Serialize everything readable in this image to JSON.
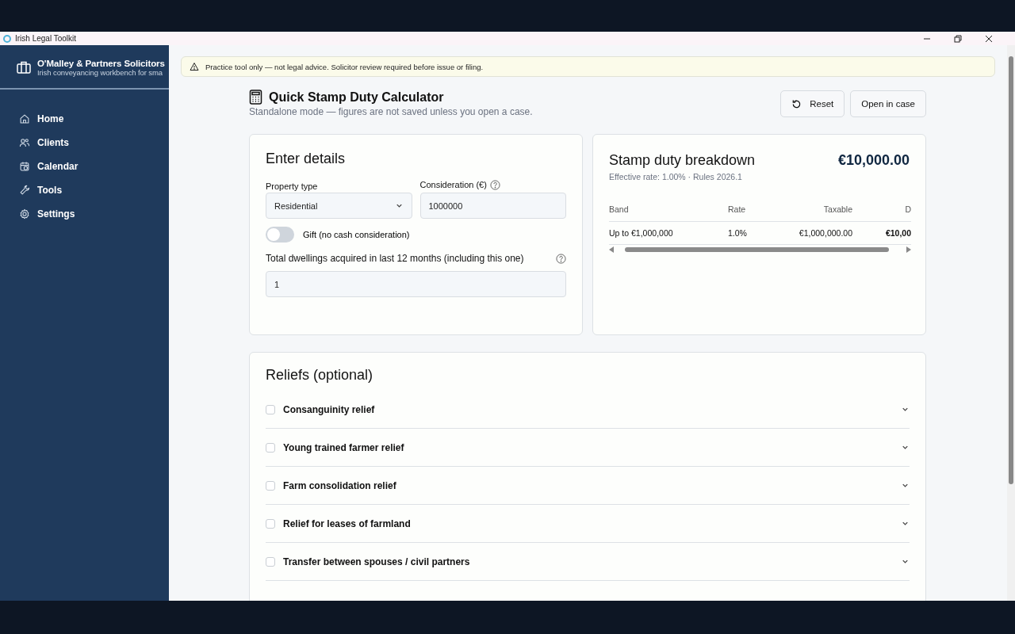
{
  "window": {
    "title": "Irish Legal Toolkit"
  },
  "sidebar": {
    "firm_name": "O'Malley & Partners Solicitors",
    "tagline": "Irish conveyancing workbench for sma",
    "items": [
      {
        "label": "Home",
        "selected": false
      },
      {
        "label": "Clients",
        "selected": false
      },
      {
        "label": "Calendar",
        "selected": false
      },
      {
        "label": "Tools",
        "selected": false
      },
      {
        "label": "Settings",
        "selected": false
      }
    ]
  },
  "banner": {
    "text": "Practice tool only — not legal advice. Solicitor review required before issue or filing."
  },
  "header": {
    "title": "Quick Stamp Duty Calculator",
    "subtitle": "Standalone mode — figures are not saved unless you open a case.",
    "buttons": [
      {
        "label": "Reset",
        "kind": "reset"
      },
      {
        "label": "Open in case",
        "kind": "plain"
      }
    ]
  },
  "details": {
    "title": "Enter details",
    "property_type": {
      "label": "Property type",
      "value": "Residential"
    },
    "consideration": {
      "label": "Consideration (€)",
      "value": "1000000"
    },
    "gift": {
      "label": "Gift (no cash consideration)",
      "on": false
    },
    "dwellings": {
      "label": "Total dwellings acquired in last 12 months (including this one)",
      "value": "1"
    }
  },
  "breakdown": {
    "title": "Stamp duty breakdown",
    "total": "€10,000.00",
    "meta": "Effective rate: 1.00% · Rules 2026.1",
    "columns": [
      "Band",
      "Rate",
      "Taxable",
      "D"
    ],
    "rows": [
      [
        "Up to €1,000,000",
        "1.0%",
        "€1,000,000.00",
        "€10,00"
      ]
    ]
  },
  "reliefs": {
    "title": "Reliefs (optional)",
    "items": [
      {
        "label": "Consanguinity relief",
        "checked": false
      },
      {
        "label": "Young trained farmer relief",
        "checked": false
      },
      {
        "label": "Farm consolidation relief",
        "checked": false
      },
      {
        "label": "Relief for leases of farmland",
        "checked": false
      },
      {
        "label": "Transfer between spouses / civil partners",
        "checked": false
      }
    ]
  }
}
